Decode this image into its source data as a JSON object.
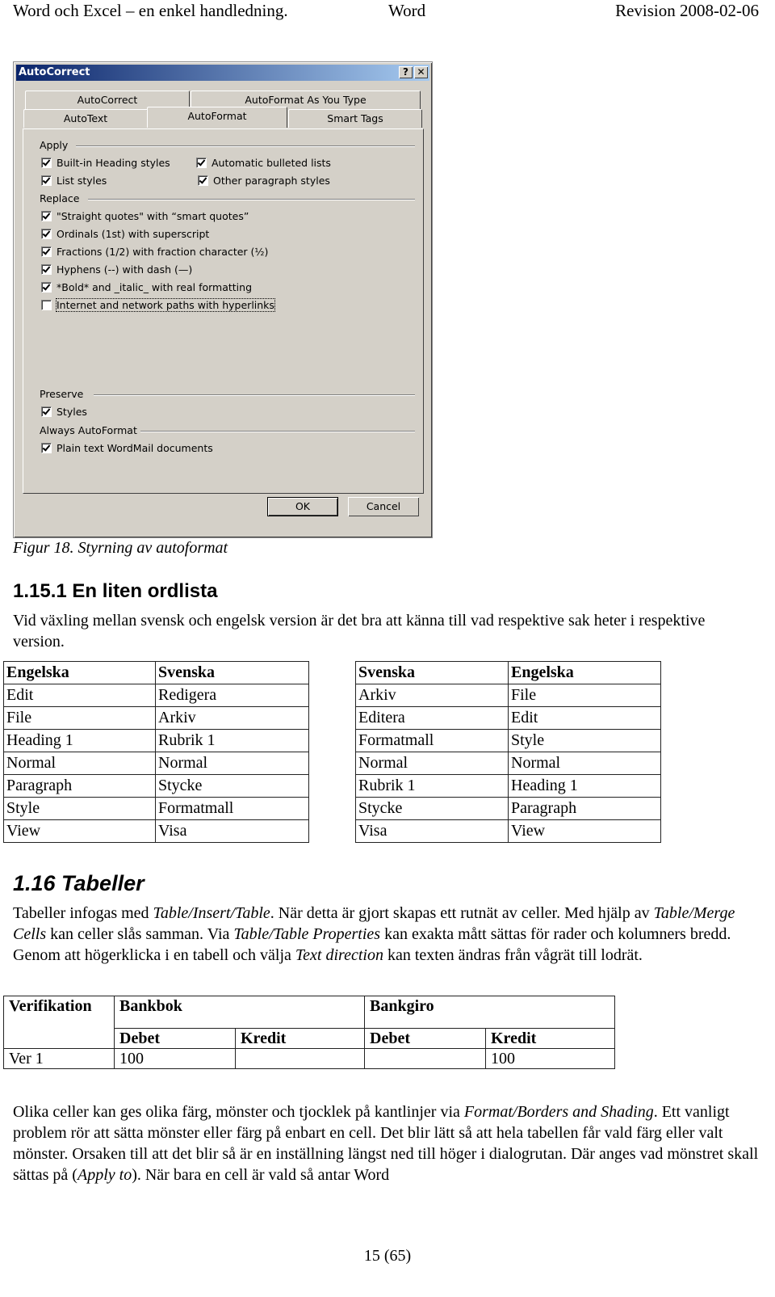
{
  "header": {
    "left": "Word och Excel – en enkel handledning.",
    "middle": "Word",
    "right": "Revision 2008-02-06"
  },
  "dialog": {
    "title": "AutoCorrect",
    "help_button": "?",
    "close_button": "✕",
    "tabs_back": [
      "AutoCorrect",
      "AutoFormat As You Type"
    ],
    "tabs_front": [
      "AutoText",
      "AutoFormat",
      "Smart Tags"
    ],
    "active_tab": "AutoFormat",
    "groups": {
      "apply": "Apply",
      "replace": "Replace",
      "preserve": "Preserve",
      "always": "Always AutoFormat"
    },
    "apply_items": [
      {
        "label": "Built-in Heading styles",
        "checked": true
      },
      {
        "label": "List styles",
        "checked": true
      },
      {
        "label": "Automatic bulleted lists",
        "checked": true
      },
      {
        "label": "Other paragraph styles",
        "checked": true
      }
    ],
    "replace_items": [
      {
        "label": "\"Straight quotes\" with “smart quotes”",
        "checked": true
      },
      {
        "label": "Ordinals (1st) with superscript",
        "checked": true
      },
      {
        "label": "Fractions (1/2) with fraction character (½)",
        "checked": true
      },
      {
        "label": "Hyphens (--) with dash (—)",
        "checked": true
      },
      {
        "label": "*Bold* and _italic_ with real formatting",
        "checked": true
      },
      {
        "label": "Internet and network paths with hyperlinks",
        "checked": false
      }
    ],
    "preserve_items": [
      {
        "label": "Styles",
        "checked": true
      }
    ],
    "always_items": [
      {
        "label": "Plain text WordMail documents",
        "checked": true
      }
    ],
    "ok": "OK",
    "cancel": "Cancel"
  },
  "caption": "Figur 18. Styrning av autoformat",
  "section_1": {
    "heading": "1.15.1 En liten ordlista",
    "intro": "Vid växling mellan svensk och engelsk version är det bra att känna till vad respektive sak heter i respektive version."
  },
  "glossary_en_sv": {
    "headers": [
      "Engelska",
      "Svenska"
    ],
    "rows": [
      [
        "Edit",
        "Redigera"
      ],
      [
        "File",
        "Arkiv"
      ],
      [
        "Heading 1",
        "Rubrik 1"
      ],
      [
        "Normal",
        "Normal"
      ],
      [
        "Paragraph",
        "Stycke"
      ],
      [
        "Style",
        "Formatmall"
      ],
      [
        "View",
        "Visa"
      ]
    ]
  },
  "glossary_sv_en": {
    "headers": [
      "Svenska",
      "Engelska"
    ],
    "rows": [
      [
        "Arkiv",
        "File"
      ],
      [
        "Editera",
        "Edit"
      ],
      [
        "Formatmall",
        "Style"
      ],
      [
        "Normal",
        "Normal"
      ],
      [
        "Rubrik 1",
        "Heading 1"
      ],
      [
        "Stycke",
        "Paragraph"
      ],
      [
        "Visa",
        "View"
      ]
    ]
  },
  "section_2": {
    "heading": "1.16 Tabeller",
    "p1": [
      {
        "t": "Tabeller infogas med "
      },
      {
        "t": "Table/Insert/Table",
        "i": true
      },
      {
        "t": ". När detta är gjort skapas ett rutnät av celler. Med hjälp av "
      },
      {
        "t": "Table/Merge Cells",
        "i": true
      },
      {
        "t": " kan celler slås samman. Via "
      },
      {
        "t": "Table/Table Properties",
        "i": true
      },
      {
        "t": " kan exakta mått sättas för rader och kolumners bredd. Genom att högerklicka i en tabell och välja "
      },
      {
        "t": "Text direction",
        "i": true
      },
      {
        "t": " kan texten ändras från vågrät till lodrät."
      }
    ],
    "p2": [
      {
        "t": "Olika celler kan ges olika färg, mönster och tjocklek på kantlinjer via "
      },
      {
        "t": "Format/Borders and Shading",
        "i": true
      },
      {
        "t": ". Ett vanligt problem rör att sätta mönster eller färg på enbart en cell. Det blir lätt så att hela tabellen får vald färg eller valt mönster. Orsaken till att det blir så är en inställning längst ned till höger i dialogrutan. Där anges vad mönstret skall sättas på ("
      },
      {
        "t": "Apply to",
        "i": true
      },
      {
        "t": "). När bara en cell är vald så antar Word"
      }
    ]
  },
  "example_table": {
    "col_verifikation": "Verifikation",
    "group_bankbok": "Bankbok",
    "group_bankgiro": "Bankgiro",
    "sub_headers": [
      "Debet",
      "Kredit",
      "Debet",
      "Kredit"
    ],
    "rows": [
      [
        "Ver 1",
        "100",
        "",
        "",
        "100"
      ]
    ]
  },
  "page_number": "15 (65)"
}
